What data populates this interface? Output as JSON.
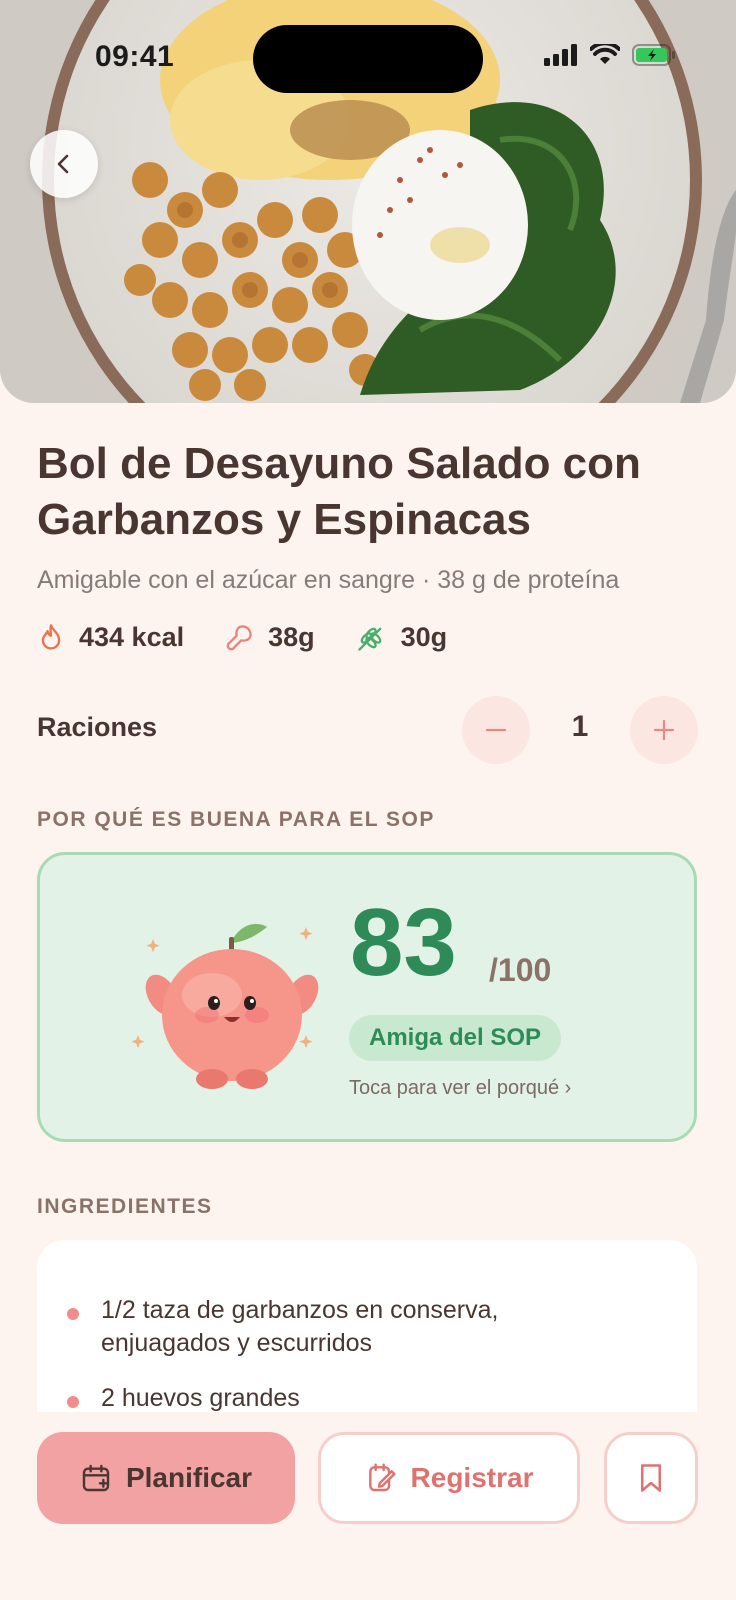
{
  "status_bar": {
    "time": "09:41"
  },
  "hero": {
    "image": "savory-breakfast-bowl-photo"
  },
  "recipe": {
    "title": "Bol de Desayuno Salado con Garbanzos y Espinacas",
    "subtitle": "Amigable con el azúcar en sangre · 38 g de proteína",
    "macros": {
      "calories": "434 kcal",
      "protein": "38g",
      "carbs": "30g"
    }
  },
  "servings": {
    "label": "Raciones",
    "value": "1",
    "minus": "−",
    "plus": "+"
  },
  "sop_section": {
    "title": "POR QUÉ ES BUENA PARA EL SOP",
    "score": "83",
    "max": "/100",
    "badge": "Amiga del SOP",
    "cta": "Toca para ver el porqué ›",
    "colors": {
      "accent": "#2E8B57",
      "card_bg": "#E3F2E6"
    }
  },
  "ingredients": {
    "title": "INGREDIENTES",
    "items": [
      "1/2 taza de garbanzos en conserva, enjuagados y escurridos",
      "2 huevos grandes"
    ]
  },
  "actions": {
    "plan": "Planificar",
    "log": "Registrar",
    "save_icon": "bookmark-icon"
  }
}
